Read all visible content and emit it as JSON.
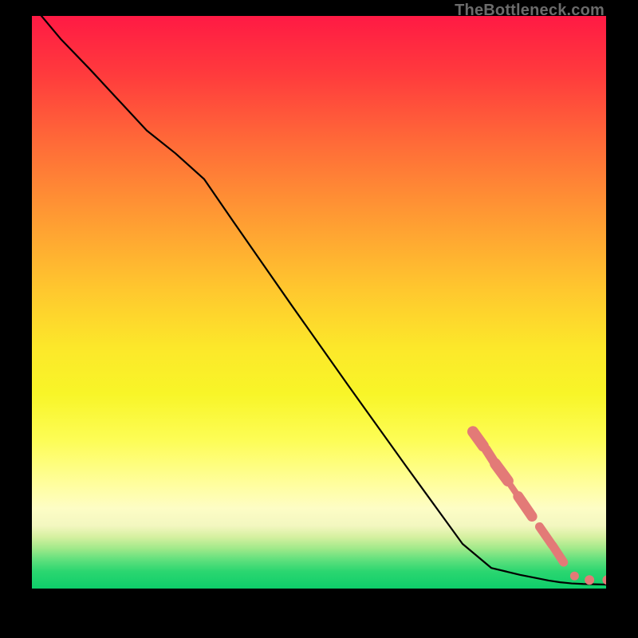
{
  "watermark": "TheBottleneck.com",
  "colors": {
    "line": "#000000",
    "marker": "#e37a77"
  },
  "chart_data": {
    "type": "line",
    "title": "",
    "xlabel": "",
    "ylabel": "",
    "xlim": [
      0,
      100
    ],
    "ylim": [
      0,
      100
    ],
    "line": {
      "x": [
        0.0,
        5.0,
        10.0,
        15.0,
        20.0,
        25.0,
        30.0,
        35.0,
        40.0,
        45.0,
        50.0,
        55.0,
        60.0,
        65.0,
        70.0,
        75.0,
        80.0,
        85.0,
        88.0,
        90.0,
        92.0,
        93.0,
        94.0,
        96.0,
        98.0,
        100.0
      ],
      "y": [
        102.0,
        96.0,
        90.8,
        85.4,
        80.0,
        76.0,
        71.5,
        64.2,
        57.0,
        49.8,
        42.7,
        35.6,
        28.6,
        21.6,
        14.7,
        7.8,
        3.6,
        2.4,
        1.8,
        1.4,
        1.1,
        1.0,
        0.9,
        0.8,
        0.75,
        0.7
      ]
    },
    "markers": [
      {
        "kind": "bar",
        "x0": 76.8,
        "x1": 78.6,
        "y0": 27.4,
        "y1": 24.9,
        "r": 7.0
      },
      {
        "kind": "bar",
        "x0": 79.1,
        "x1": 80.5,
        "y0": 24.3,
        "y1": 22.1,
        "r": 6.0
      },
      {
        "kind": "bar",
        "x0": 80.7,
        "x1": 82.9,
        "y0": 21.8,
        "y1": 18.8,
        "r": 7.0
      },
      {
        "kind": "bar",
        "x0": 83.4,
        "x1": 84.7,
        "y0": 18.0,
        "y1": 16.1,
        "r": 4.0
      },
      {
        "kind": "bar",
        "x0": 84.7,
        "x1": 87.1,
        "y0": 16.1,
        "y1": 12.6,
        "r": 6.5
      },
      {
        "kind": "bar",
        "x0": 88.4,
        "x1": 90.6,
        "y0": 10.8,
        "y1": 7.6,
        "r": 5.5
      },
      {
        "kind": "bar",
        "x0": 90.7,
        "x1": 92.6,
        "y0": 7.5,
        "y1": 4.6,
        "r": 5.5
      },
      {
        "kind": "dot",
        "x": 94.5,
        "y": 2.2,
        "r": 5.5
      },
      {
        "kind": "dot",
        "x": 97.1,
        "y": 1.5,
        "r": 6.0
      },
      {
        "kind": "dot",
        "x": 100.2,
        "y": 1.5,
        "r": 6.0
      }
    ]
  }
}
